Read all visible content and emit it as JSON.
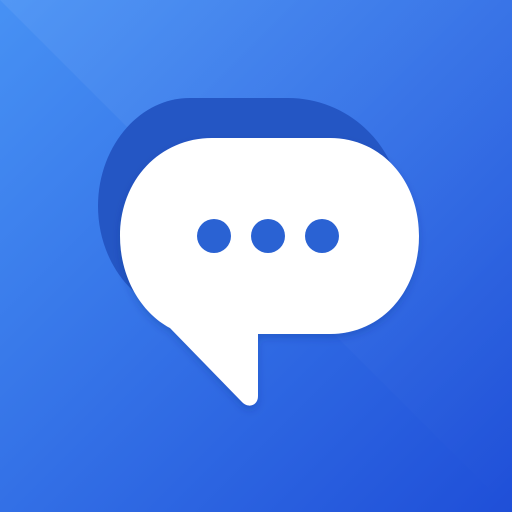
{
  "icon": {
    "name": "chat-bubble-typing-icon",
    "colors": {
      "background_light": "#4791F4",
      "background_dark": "#1F4FD8",
      "bubble_shadow": "#2456C4",
      "bubble": "#FFFFFF",
      "dots": "#2A62D3"
    }
  }
}
